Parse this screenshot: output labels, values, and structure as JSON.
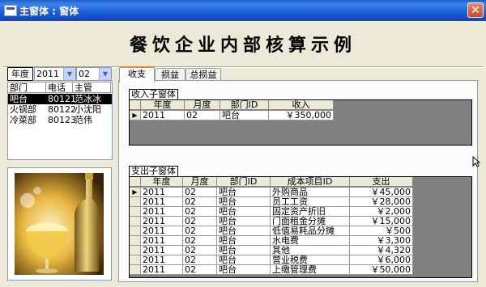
{
  "window": {
    "title": "主窗体 : 窗体",
    "close_symbol": "✕"
  },
  "heading": "餐饮企业内部核算示例",
  "filters": {
    "year_label": "年度",
    "year_value": "2011",
    "month_value": "02"
  },
  "departments": {
    "headers": [
      "部门",
      "电话",
      "主管"
    ],
    "rows": [
      {
        "dept": "吧台",
        "phone": "80121",
        "manager": "范冰冰",
        "selected": true
      },
      {
        "dept": "火锅部",
        "phone": "80122",
        "manager": "小沈阳",
        "selected": false
      },
      {
        "dept": "冷菜部",
        "phone": "80123",
        "manager": "范伟",
        "selected": false
      }
    ]
  },
  "tabs": [
    "收支",
    "损益",
    "总损益"
  ],
  "income": {
    "label": "收入子窗体",
    "headers": [
      "年度",
      "月度",
      "部门ID",
      "收入"
    ],
    "rows": [
      {
        "year": "2011",
        "month": "02",
        "dept": "吧台",
        "amount": "￥350,000"
      }
    ]
  },
  "expense": {
    "label": "支出子窗体",
    "headers": [
      "年度",
      "月度",
      "部门ID",
      "成本项目ID",
      "支出"
    ],
    "rows": [
      {
        "year": "2011",
        "month": "02",
        "dept": "吧台",
        "item": "外购商品",
        "amount": "￥45,000"
      },
      {
        "year": "2011",
        "month": "02",
        "dept": "吧台",
        "item": "员工工资",
        "amount": "￥28,000"
      },
      {
        "year": "2011",
        "month": "02",
        "dept": "吧台",
        "item": "固定资产折旧",
        "amount": "￥2,000"
      },
      {
        "year": "2011",
        "month": "02",
        "dept": "吧台",
        "item": "门面租金分摊",
        "amount": "￥15,000"
      },
      {
        "year": "2011",
        "month": "02",
        "dept": "吧台",
        "item": "低值易耗品分摊",
        "amount": "￥500"
      },
      {
        "year": "2011",
        "month": "02",
        "dept": "吧台",
        "item": "水电费",
        "amount": "￥3,300"
      },
      {
        "year": "2011",
        "month": "02",
        "dept": "吧台",
        "item": "其他",
        "amount": "￥4,320"
      },
      {
        "year": "2011",
        "month": "02",
        "dept": "吧台",
        "item": "营业税费",
        "amount": "￥6,000"
      },
      {
        "year": "2011",
        "month": "02",
        "dept": "吧台",
        "item": "上缴管理费",
        "amount": "￥50,000"
      }
    ]
  },
  "icons": [
    "form-icon",
    "close-icon",
    "dropdown-arrow-icon",
    "record-selector-icon",
    "pointer-cursor-icon"
  ],
  "colors": {
    "titlebar": "#1b5dd6",
    "selection": "#000000",
    "grid_bg": "#808080",
    "tab_highlight": "#e68b2c"
  }
}
